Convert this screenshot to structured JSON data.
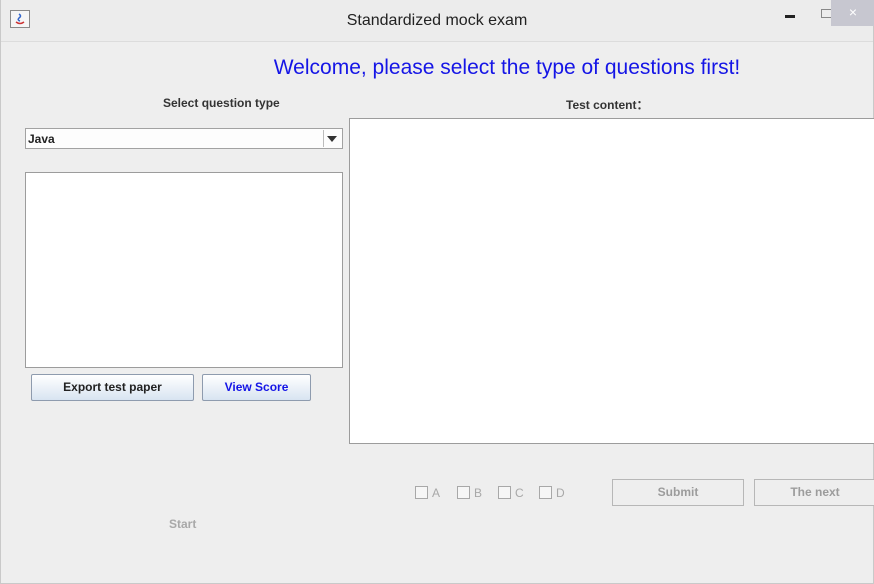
{
  "window": {
    "title": "Standardized mock exam",
    "close_glyph": "×",
    "icon": "java-icon"
  },
  "header": {
    "welcome": "Welcome, please select the type of questions first!"
  },
  "left_panel": {
    "heading": "Select question type",
    "question_type": {
      "selected": "Java"
    },
    "export_button": "Export test paper",
    "score_button": "View Score",
    "start_label": "Start"
  },
  "right_panel": {
    "heading": "Test content："
  },
  "answers": {
    "options": [
      "A",
      "B",
      "C",
      "D"
    ],
    "submit_button": "Submit",
    "next_button": "The next"
  },
  "colors": {
    "welcome_text": "#1515e6",
    "score_text": "#1515e6",
    "disabled_text": "#9c9c9c"
  }
}
